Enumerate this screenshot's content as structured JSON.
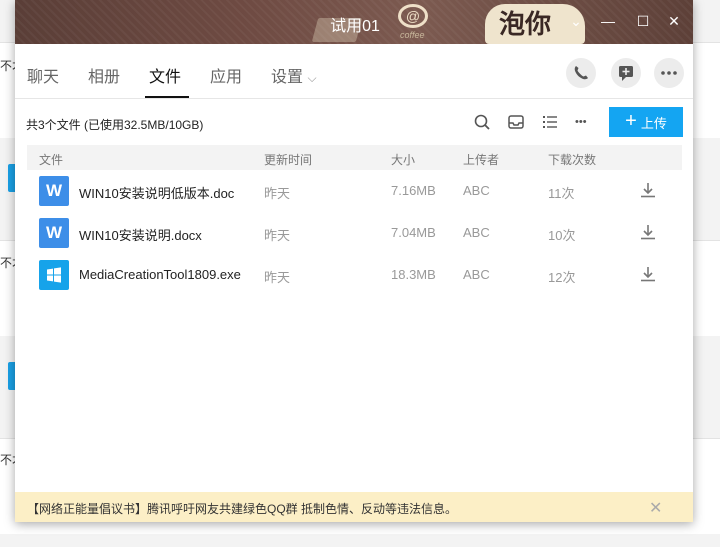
{
  "background": {
    "row_text": "不才"
  },
  "window": {
    "title": "试用01",
    "banner_text": "泡你",
    "banner_small": "coffee",
    "controls": {
      "dropdown": "⌄",
      "minimize": "—",
      "maximize": "☐",
      "close": "✕"
    }
  },
  "tabs": [
    {
      "label": "聊天"
    },
    {
      "label": "相册"
    },
    {
      "label": "文件"
    },
    {
      "label": "应用"
    },
    {
      "label": "设置"
    }
  ],
  "tab_settings_arrow": "⌵",
  "toolbar": {
    "summary": "共3个文件 (已使用32.5MB/10GB)",
    "upload_label": "上传",
    "upload_plus": "+",
    "more_label": "•••"
  },
  "table": {
    "headers": {
      "file": "文件",
      "updated": "更新时间",
      "size": "大小",
      "uploader": "上传者",
      "downloads": "下载次数"
    },
    "rows": [
      {
        "name": "WIN10安装说明低版本.doc",
        "updated": "昨天",
        "size": "7.16MB",
        "uploader": "ABC",
        "downloads": "11次",
        "type": "word",
        "icon_letter": "W"
      },
      {
        "name": "WIN10安装说明.docx",
        "updated": "昨天",
        "size": "7.04MB",
        "uploader": "ABC",
        "downloads": "10次",
        "type": "word",
        "icon_letter": "W"
      },
      {
        "name": "MediaCreationTool1809.exe",
        "updated": "昨天",
        "size": "18.3MB",
        "uploader": "ABC",
        "downloads": "12次",
        "type": "exe",
        "icon_letter": ""
      }
    ]
  },
  "notice": {
    "text": "【网络正能量倡议书】腾讯呼吁网友共建绿色QQ群 抵制色情、反动等违法信息。",
    "close": "✕"
  },
  "colors": {
    "accent": "#14a5f2",
    "titlebar": "#6f4b43",
    "notice_bg": "#fcefc6"
  }
}
